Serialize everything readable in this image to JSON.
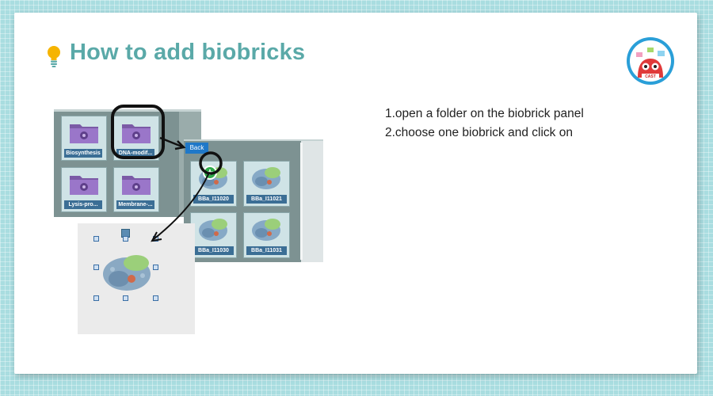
{
  "title": "How to add biobricks",
  "steps": [
    "1.open a folder on the biobrick panel",
    "2.choose one biobrick and click on"
  ],
  "logo_text": "CAST",
  "folder_panel": {
    "folders": [
      {
        "label": "Biosynthesis"
      },
      {
        "label": "DNA-modif..."
      },
      {
        "label": "Lysis-pro..."
      },
      {
        "label": "Membrane-..."
      }
    ]
  },
  "biobrick_panel": {
    "back_label": "Back",
    "add_symbol": "+",
    "bricks": [
      {
        "label": "BBa_I11020"
      },
      {
        "label": "BBa_I11021"
      },
      {
        "label": "BBa_I11030"
      },
      {
        "label": "BBa_I11031"
      }
    ]
  },
  "colors": {
    "title": "#5aa9a8",
    "panel_bg": "#7d9292",
    "label_bg": "#3b6e95",
    "back_button": "#1f78c8",
    "add_button": "#2da84a"
  }
}
